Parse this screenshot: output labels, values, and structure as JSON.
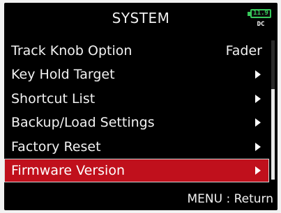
{
  "screen": {
    "title": "SYSTEM",
    "battery": {
      "level": "11.9",
      "source": "DC",
      "color": "#37c85a"
    }
  },
  "menu": {
    "items": [
      {
        "label": "Track Knob Option",
        "value": "Fader",
        "has_submenu": false,
        "selected": false
      },
      {
        "label": "Key Hold Target",
        "value": "",
        "has_submenu": true,
        "selected": false
      },
      {
        "label": "Shortcut List",
        "value": "",
        "has_submenu": true,
        "selected": false
      },
      {
        "label": "Backup/Load Settings",
        "value": "",
        "has_submenu": true,
        "selected": false
      },
      {
        "label": "Factory Reset",
        "value": "",
        "has_submenu": true,
        "selected": false
      },
      {
        "label": "Firmware Version",
        "value": "",
        "has_submenu": true,
        "selected": true
      }
    ],
    "selected_color": "#c0101c"
  },
  "footer": {
    "hint": "MENU : Return"
  },
  "icons": {
    "submenu_arrow": "play-triangle-icon",
    "battery": "battery-icon"
  }
}
